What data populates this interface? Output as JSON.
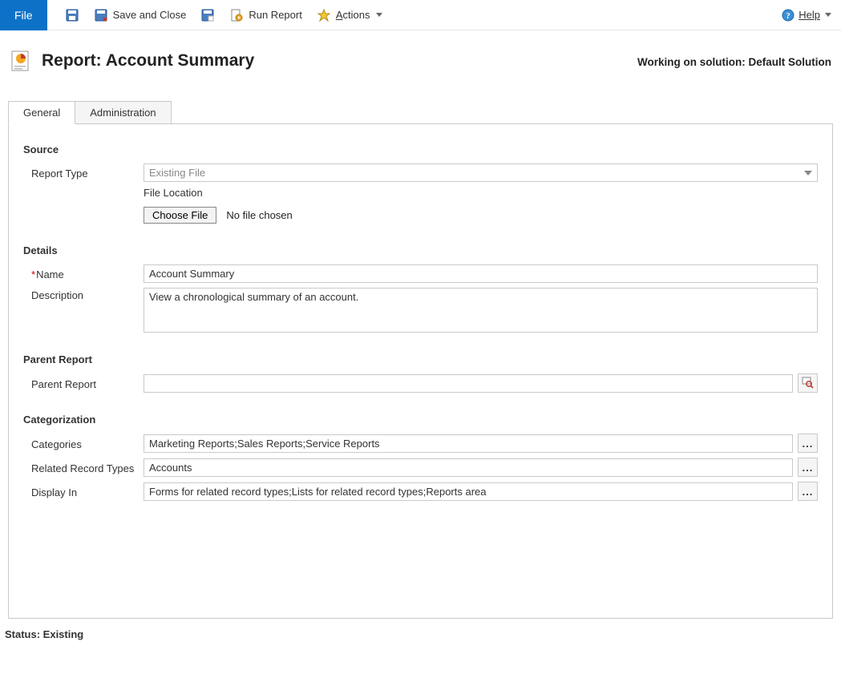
{
  "topbar": {
    "file": "File",
    "save_close": "Save and Close",
    "run_report": "Run Report",
    "actions_prefix": "A",
    "actions_rest": "ctions",
    "help_prefix": "H",
    "help_rest": "elp"
  },
  "title": {
    "prefix": "Report: ",
    "name": "Account Summary"
  },
  "solution": {
    "label": "Working on solution: ",
    "name": "Default Solution"
  },
  "tabs": {
    "general": "General",
    "administration": "Administration"
  },
  "sections": {
    "source": "Source",
    "details": "Details",
    "parent": "Parent Report",
    "categorization": "Categorization"
  },
  "labels": {
    "report_type": "Report Type",
    "file_location": "File Location",
    "choose_file": "Choose File",
    "no_file": "No file chosen",
    "name": "Name",
    "description": "Description",
    "parent_report": "Parent Report",
    "categories": "Categories",
    "related_record_types": "Related Record Types",
    "display_in": "Display In"
  },
  "values": {
    "report_type": "Existing File",
    "name": "Account Summary",
    "description": "View a chronological summary of an account.",
    "parent_report": "",
    "categories": "Marketing Reports;Sales Reports;Service Reports",
    "related_record_types": "Accounts",
    "display_in": "Forms for related record types;Lists for related record types;Reports area"
  },
  "status": {
    "label": "Status: ",
    "value": "Existing"
  },
  "ellipsis": "..."
}
